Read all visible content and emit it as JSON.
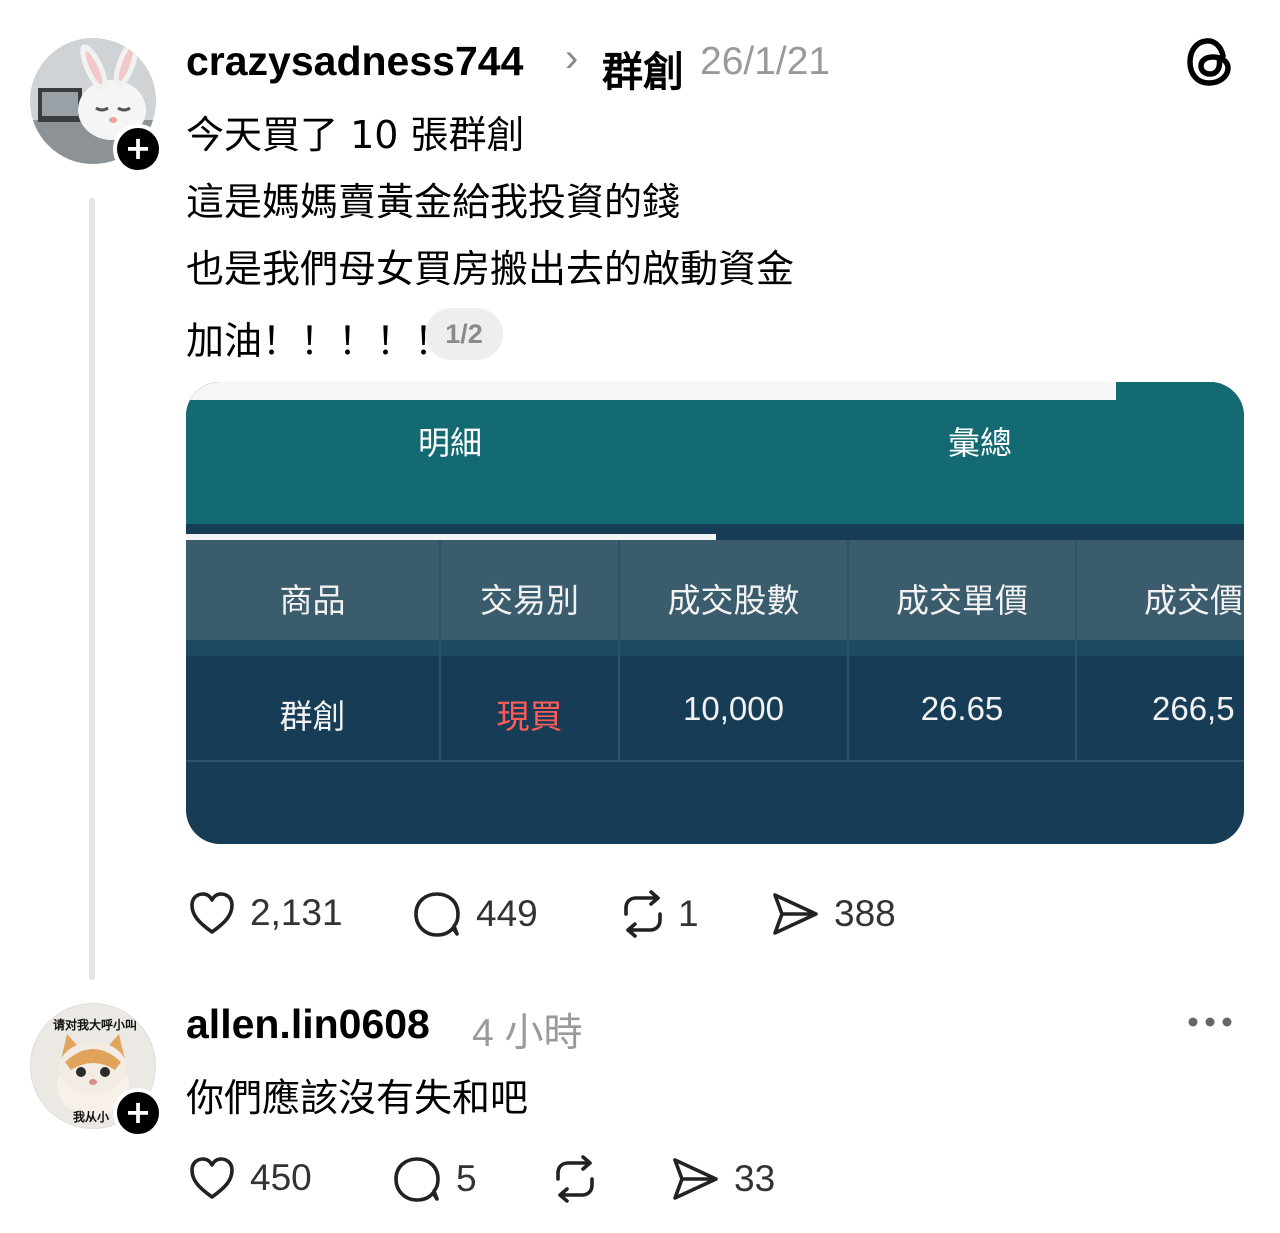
{
  "post": {
    "username": "crazysadness744",
    "community": "群創",
    "date": "26/1/21",
    "lines": [
      "今天買了 10 張群創",
      "這是媽媽賣黃金給我投資的錢",
      "也是我們母女買房搬出去的啟動資金",
      "加油！！！！！"
    ],
    "image_counter": "1/2",
    "stats": {
      "likes": "2,131",
      "comments": "449",
      "reposts": "1",
      "shares": "388"
    }
  },
  "trade_screenshot": {
    "tabs": [
      "明細",
      "彙總"
    ],
    "columns": [
      "商品",
      "交易別",
      "成交股數",
      "成交單價",
      "成交價"
    ],
    "row": [
      "群創",
      "現買",
      "10,000",
      "26.65",
      "266,5"
    ],
    "colors": {
      "buy": "#ff5b57",
      "tab_bg": "#136a73",
      "header_bg": "#3a5c6c",
      "row_bg": "#163d55"
    }
  },
  "reply": {
    "username": "allen.lin0608",
    "time": "4 小時",
    "text": "你們應該沒有失和吧",
    "avatar_caption_top": "请对我大呼小叫",
    "avatar_caption_bottom": "我从小",
    "stats": {
      "likes": "450",
      "comments": "5",
      "shares": "33"
    }
  },
  "icons": {
    "follow": "+",
    "chevron": "›",
    "like": "heart-icon",
    "comment": "comment-bubble-icon",
    "repost": "repost-icon",
    "share": "send-icon",
    "more": "more-dots-icon",
    "app": "threads-logo-icon"
  }
}
